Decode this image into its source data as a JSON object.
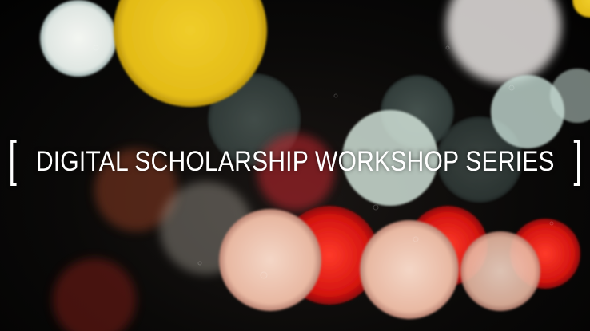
{
  "banner": {
    "open_bracket": "[",
    "title": "DIGITAL SCHOLARSHIP WORKSHOP SERIES",
    "close_bracket": "]"
  },
  "colors": {
    "background": "#050505",
    "bokeh_yellow": "#e8c21c",
    "bokeh_red": "#e01818",
    "bokeh_white": "#e8ece6",
    "text": "#ffffff"
  }
}
